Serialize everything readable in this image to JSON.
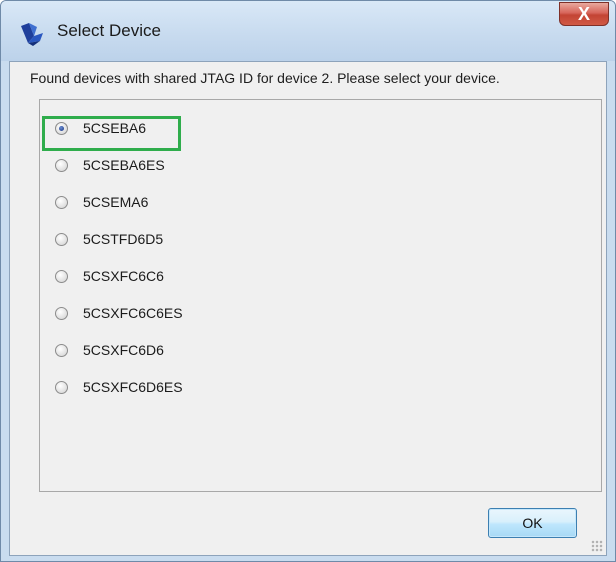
{
  "window": {
    "title": "Select Device",
    "close_label": "X"
  },
  "message": "Found devices with shared JTAG ID for device 2. Please select your device.",
  "devices": [
    {
      "label": "5CSEBA6",
      "selected": true
    },
    {
      "label": "5CSEBA6ES",
      "selected": false
    },
    {
      "label": "5CSEMA6",
      "selected": false
    },
    {
      "label": "5CSTFD6D5",
      "selected": false
    },
    {
      "label": "5CSXFC6C6",
      "selected": false
    },
    {
      "label": "5CSXFC6C6ES",
      "selected": false
    },
    {
      "label": "5CSXFC6D6",
      "selected": false
    },
    {
      "label": "5CSXFC6D6ES",
      "selected": false
    }
  ],
  "ok_label": "OK",
  "colors": {
    "highlight": "#2fad4c",
    "titlebar": "#c9dcef",
    "close": "#c34434"
  }
}
